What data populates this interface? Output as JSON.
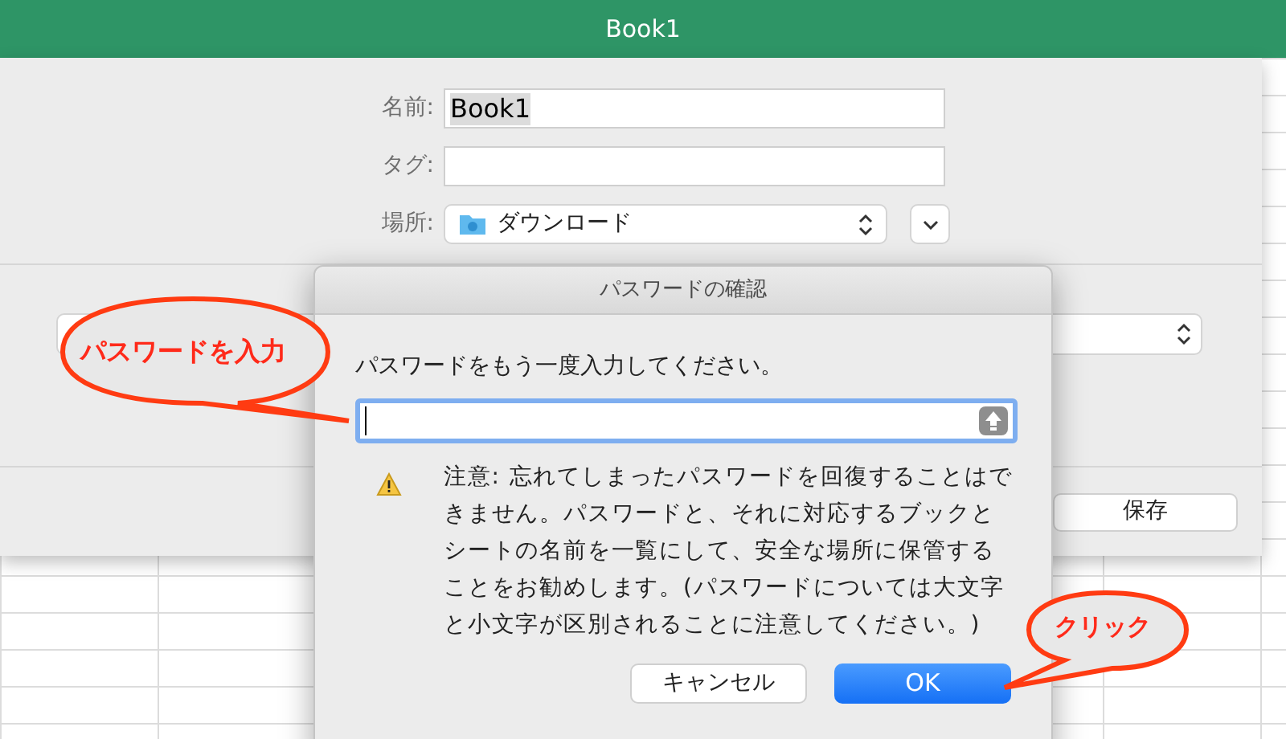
{
  "window": {
    "title": "Book1"
  },
  "save_sheet": {
    "name_field": {
      "label": "名前:",
      "value": "Book1"
    },
    "tag_field": {
      "label": "タグ:"
    },
    "location_field": {
      "label": "場所:",
      "value": "ダウンロード"
    },
    "save_button": "保存"
  },
  "password_dialog": {
    "title": "パスワードの確認",
    "prompt": "パスワードをもう一度入力してください。",
    "warning": "注意: 忘れてしまったパスワードを回復することはできません。パスワードと、それに対応するブックとシートの名前を一覧にして、安全な場所に保管することをお勧めします。(パスワードについては大文字と小文字が区別されることに注意してください。)",
    "buttons": [
      {
        "label": "キャンセル",
        "kind": "secondary"
      },
      {
        "label": "OK",
        "kind": "primary"
      }
    ]
  },
  "callouts": [
    {
      "text": "パスワードを入力",
      "kind": "left"
    },
    {
      "text": "クリック",
      "kind": "right"
    }
  ]
}
